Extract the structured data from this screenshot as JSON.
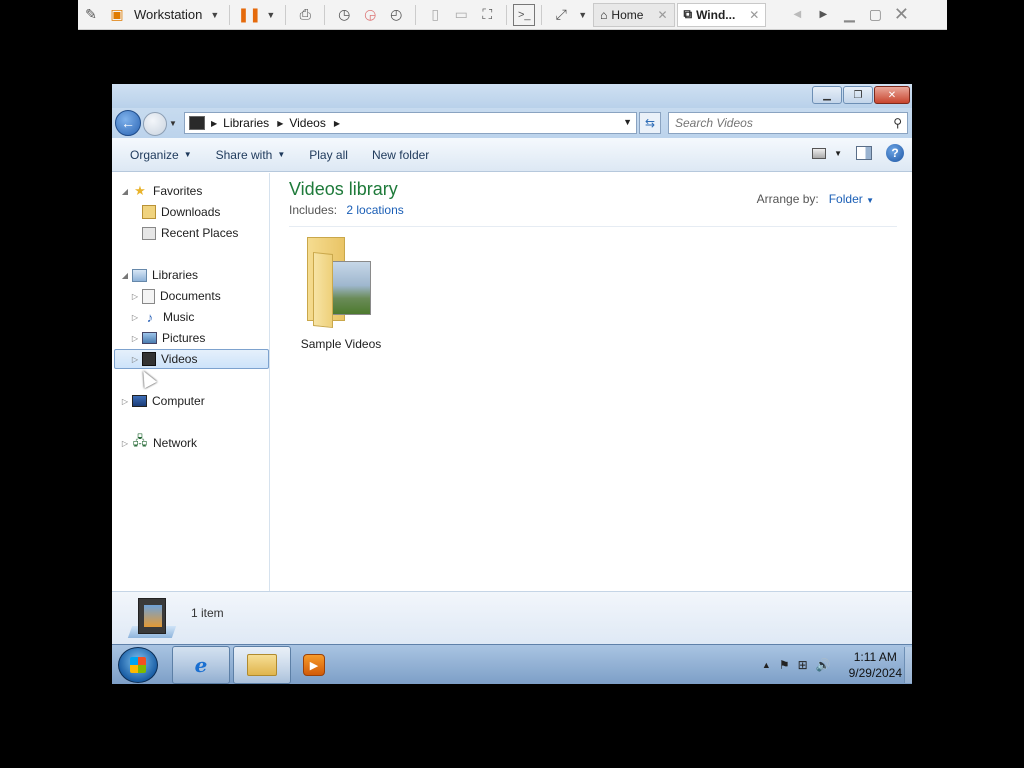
{
  "vmware": {
    "title": "Workstation",
    "tabs": [
      {
        "label": "Home",
        "active": false
      },
      {
        "label": "Wind...",
        "active": true
      }
    ]
  },
  "window": {
    "address": {
      "crumbs": [
        "Libraries",
        "Videos"
      ],
      "search_placeholder": "Search Videos"
    },
    "commands": {
      "organize": "Organize",
      "share_with": "Share with",
      "play_all": "Play all",
      "new_folder": "New folder"
    },
    "nav": {
      "favorites": "Favorites",
      "downloads": "Downloads",
      "recent_places": "Recent Places",
      "libraries": "Libraries",
      "documents": "Documents",
      "music": "Music",
      "pictures": "Pictures",
      "videos": "Videos",
      "computer": "Computer",
      "network": "Network"
    },
    "content": {
      "title": "Videos library",
      "includes_label": "Includes:",
      "locations_link": "2 locations",
      "arrange_label": "Arrange by:",
      "arrange_value": "Folder",
      "items": [
        {
          "name": "Sample Videos"
        }
      ]
    },
    "details": {
      "count": "1 item"
    }
  },
  "taskbar": {
    "time": "1:11 AM",
    "date": "9/29/2024"
  }
}
